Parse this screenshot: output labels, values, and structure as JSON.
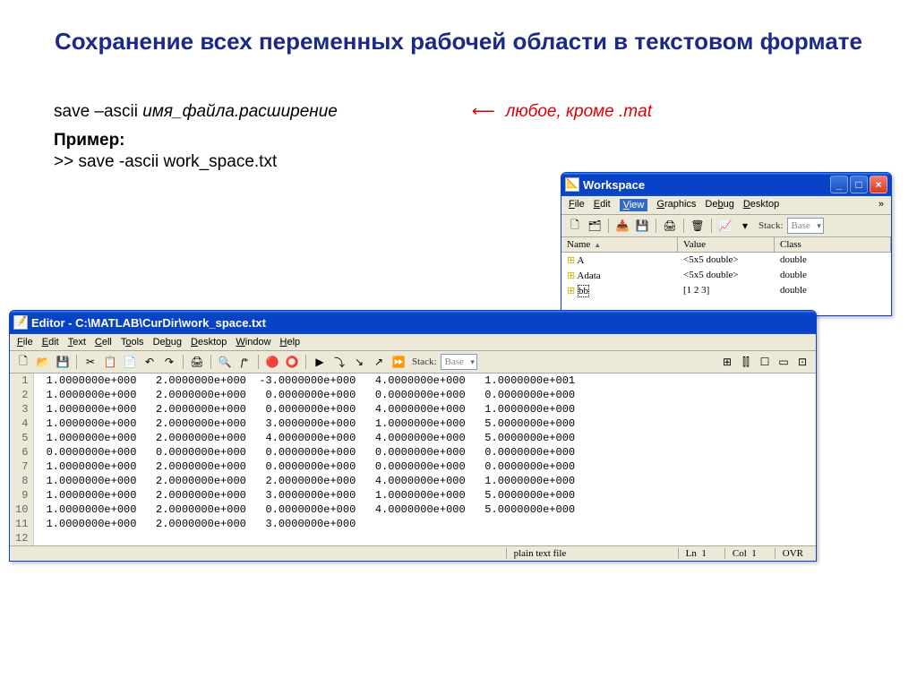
{
  "slide": {
    "title": "Сохранение всех переменных рабочей области в текстовом формате",
    "syntax_cmd": "save –ascii ",
    "syntax_placeholder": "имя_файла.расширение",
    "red_note": "любое, кроме .mat",
    "example_label": "Пример:",
    "example_code": ">> save -ascii work_space.txt"
  },
  "editor": {
    "title": "Editor - C:\\MATLAB\\CurDir\\work_space.txt",
    "menus": [
      "File",
      "Edit",
      "Text",
      "Cell",
      "Tools",
      "Debug",
      "Desktop",
      "Window",
      "Help"
    ],
    "stack_label": "Stack:",
    "stack_value": "Base",
    "rows": [
      " 1.0000000e+000   2.0000000e+000  -3.0000000e+000   4.0000000e+000   1.0000000e+001",
      " 1.0000000e+000   2.0000000e+000   0.0000000e+000   0.0000000e+000   0.0000000e+000",
      " 1.0000000e+000   2.0000000e+000   0.0000000e+000   4.0000000e+000   1.0000000e+000",
      " 1.0000000e+000   2.0000000e+000   3.0000000e+000   1.0000000e+000   5.0000000e+000",
      " 1.0000000e+000   2.0000000e+000   4.0000000e+000   4.0000000e+000   5.0000000e+000",
      " 0.0000000e+000   0.0000000e+000   0.0000000e+000   0.0000000e+000   0.0000000e+000",
      " 1.0000000e+000   2.0000000e+000   0.0000000e+000   0.0000000e+000   0.0000000e+000",
      " 1.0000000e+000   2.0000000e+000   2.0000000e+000   4.0000000e+000   1.0000000e+000",
      " 1.0000000e+000   2.0000000e+000   3.0000000e+000   1.0000000e+000   5.0000000e+000",
      " 1.0000000e+000   2.0000000e+000   0.0000000e+000   4.0000000e+000   5.0000000e+000",
      " 1.0000000e+000   2.0000000e+000   3.0000000e+000",
      ""
    ],
    "status": {
      "filetype": "plain text file",
      "ln_label": "Ln",
      "ln": "1",
      "col_label": "Col",
      "col": "1",
      "ovr": "OVR"
    }
  },
  "workspace": {
    "title": "Workspace",
    "menus": [
      "File",
      "Edit",
      "View",
      "Graphics",
      "Debug",
      "Desktop"
    ],
    "more": "»",
    "stack_label": "Stack:",
    "stack_value": "Base",
    "headers": {
      "name": "Name",
      "sort": "▲",
      "value": "Value",
      "class": "Class"
    },
    "vars": [
      {
        "name": "A",
        "value": "<5x5 double>",
        "class": "double"
      },
      {
        "name": "Adata",
        "value": "<5x5 double>",
        "class": "double"
      },
      {
        "name": "bb",
        "value": "[1 2 3]",
        "class": "double"
      }
    ]
  }
}
